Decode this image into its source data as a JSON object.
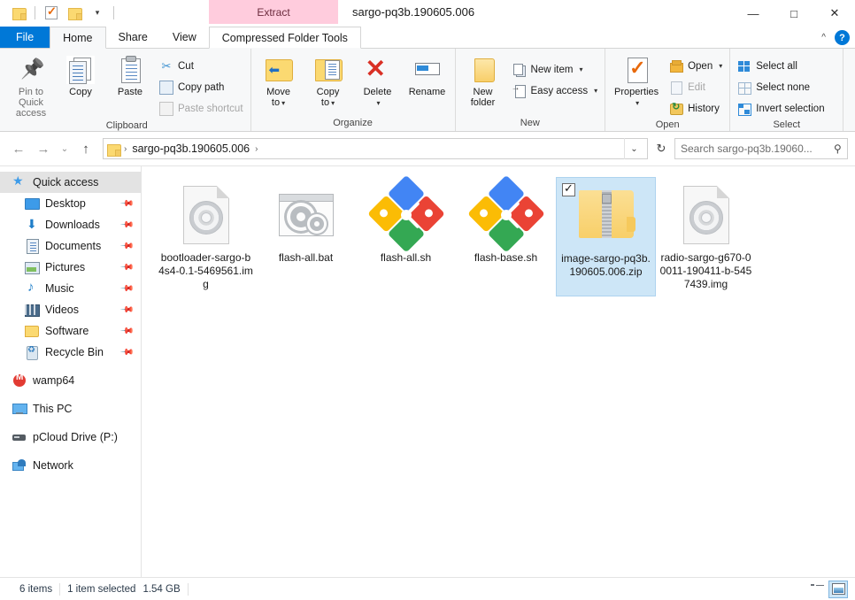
{
  "window": {
    "title": "sargo-pq3b.190605.006",
    "contextual_tab_group": "Extract",
    "controls": {
      "minimize": "—",
      "maximize": "□",
      "close": "✕"
    },
    "collapse_ribbon": "^",
    "help": "?"
  },
  "quick_access_toolbar": {
    "items": [
      {
        "name": "folder-icon",
        "label": ""
      },
      {
        "name": "properties-icon",
        "label": ""
      },
      {
        "name": "new-folder-icon",
        "label": ""
      },
      {
        "name": "customize-dropdown",
        "label": "▾"
      }
    ]
  },
  "tabs": [
    {
      "id": "file",
      "label": "File"
    },
    {
      "id": "home",
      "label": "Home"
    },
    {
      "id": "share",
      "label": "Share"
    },
    {
      "id": "view",
      "label": "View"
    },
    {
      "id": "compressed",
      "label": "Compressed Folder Tools"
    }
  ],
  "ribbon": {
    "groups": [
      {
        "title": "Clipboard",
        "big": [
          {
            "label_line1": "Pin to Quick",
            "label_line2": "access",
            "icon": "pin-icon",
            "dim": true
          },
          {
            "label_line1": "Copy",
            "label_line2": "",
            "icon": "copy-icon",
            "dim": false
          },
          {
            "label_line1": "Paste",
            "label_line2": "",
            "icon": "paste-icon",
            "dim": false
          }
        ],
        "small": [
          {
            "label": "Cut",
            "icon": "scissors-icon",
            "disabled": false
          },
          {
            "label": "Copy path",
            "icon": "copy-path-icon",
            "disabled": false
          },
          {
            "label": "Paste shortcut",
            "icon": "paste-shortcut-icon",
            "disabled": true
          }
        ]
      },
      {
        "title": "Organize",
        "big": [
          {
            "label_line1": "Move",
            "label_line2": "to",
            "icon": "move-to-icon",
            "caret": true
          },
          {
            "label_line1": "Copy",
            "label_line2": "to",
            "icon": "copy-to-icon",
            "caret": true
          },
          {
            "label_line1": "Delete",
            "label_line2": "",
            "icon": "delete-icon",
            "caret": true
          },
          {
            "label_line1": "Rename",
            "label_line2": "",
            "icon": "rename-icon",
            "caret": false
          }
        ],
        "small": []
      },
      {
        "title": "New",
        "big": [
          {
            "label_line1": "New",
            "label_line2": "folder",
            "icon": "new-folder-icon",
            "caret": false
          }
        ],
        "small": [
          {
            "label": "New item",
            "icon": "new-item-icon",
            "caret": true
          },
          {
            "label": "Easy access",
            "icon": "easy-access-icon",
            "caret": true
          }
        ]
      },
      {
        "title": "Open",
        "big": [
          {
            "label_line1": "Properties",
            "label_line2": "",
            "icon": "properties-icon",
            "caret": true
          }
        ],
        "small": [
          {
            "label": "Open",
            "icon": "open-icon",
            "caret": true,
            "disabled": false
          },
          {
            "label": "Edit",
            "icon": "edit-icon",
            "caret": false,
            "disabled": true
          },
          {
            "label": "History",
            "icon": "history-icon",
            "caret": false,
            "disabled": false
          }
        ]
      },
      {
        "title": "Select",
        "big": [],
        "small": [
          {
            "label": "Select all",
            "icon": "select-all-icon"
          },
          {
            "label": "Select none",
            "icon": "select-none-icon"
          },
          {
            "label": "Invert selection",
            "icon": "invert-selection-icon"
          }
        ]
      }
    ]
  },
  "address_bar": {
    "back": "←",
    "forward": "→",
    "recent": "⌄",
    "up": "↑",
    "breadcrumbs": [
      "sargo-pq3b.190605.006"
    ],
    "dropdown": "⌄",
    "refresh": "↻",
    "search_placeholder": "Search sargo-pq3b.19060...",
    "search_value": ""
  },
  "sidebar": {
    "items": [
      {
        "label": "Quick access",
        "icon": "star-icon",
        "level": "root",
        "selected": true,
        "pinned": false
      },
      {
        "label": "Desktop",
        "icon": "desktop-icon",
        "level": "child",
        "selected": false,
        "pinned": true
      },
      {
        "label": "Downloads",
        "icon": "downloads-icon",
        "level": "child",
        "selected": false,
        "pinned": true
      },
      {
        "label": "Documents",
        "icon": "documents-icon",
        "level": "child",
        "selected": false,
        "pinned": true
      },
      {
        "label": "Pictures",
        "icon": "pictures-icon",
        "level": "child",
        "selected": false,
        "pinned": true
      },
      {
        "label": "Music",
        "icon": "music-icon",
        "level": "child",
        "selected": false,
        "pinned": true
      },
      {
        "label": "Videos",
        "icon": "videos-icon",
        "level": "child",
        "selected": false,
        "pinned": true
      },
      {
        "label": "Software",
        "icon": "folder-icon",
        "level": "child",
        "selected": false,
        "pinned": true
      },
      {
        "label": "Recycle Bin",
        "icon": "recycle-bin-icon",
        "level": "child",
        "selected": false,
        "pinned": true
      },
      {
        "label": "wamp64",
        "icon": "wamp-icon",
        "level": "root",
        "selected": false,
        "pinned": false
      },
      {
        "label": "This PC",
        "icon": "this-pc-icon",
        "level": "root",
        "selected": false,
        "pinned": false
      },
      {
        "label": "pCloud Drive (P:)",
        "icon": "drive-icon",
        "level": "root",
        "selected": false,
        "pinned": false
      },
      {
        "label": "Network",
        "icon": "network-icon",
        "level": "root",
        "selected": false,
        "pinned": false
      }
    ]
  },
  "files": [
    {
      "name": "bootloader-sargo-b4s4-0.1-5469561.img",
      "icon": "disc-image-icon",
      "selected": false
    },
    {
      "name": "flash-all.bat",
      "icon": "batch-script-icon",
      "selected": false
    },
    {
      "name": "flash-all.sh",
      "icon": "git-bash-script-icon",
      "selected": false
    },
    {
      "name": "flash-base.sh",
      "icon": "git-bash-script-icon",
      "selected": false
    },
    {
      "name": "image-sargo-pq3b.190605.006.zip",
      "icon": "zip-archive-icon",
      "selected": true
    },
    {
      "name": "radio-sargo-g670-00011-190411-b-5457439.img",
      "icon": "disc-image-icon",
      "selected": false
    }
  ],
  "status_bar": {
    "item_count": "6 items",
    "selection": "1 item selected",
    "selection_size": "1.54 GB",
    "views": [
      {
        "name": "details-view",
        "active": false
      },
      {
        "name": "large-icons-view",
        "active": true
      }
    ]
  },
  "colors": {
    "accent": "#0078d7",
    "contextual_tab": "#ffccdd",
    "selection": "#cde6f7",
    "ribbon_bg": "#f7f8f9"
  }
}
